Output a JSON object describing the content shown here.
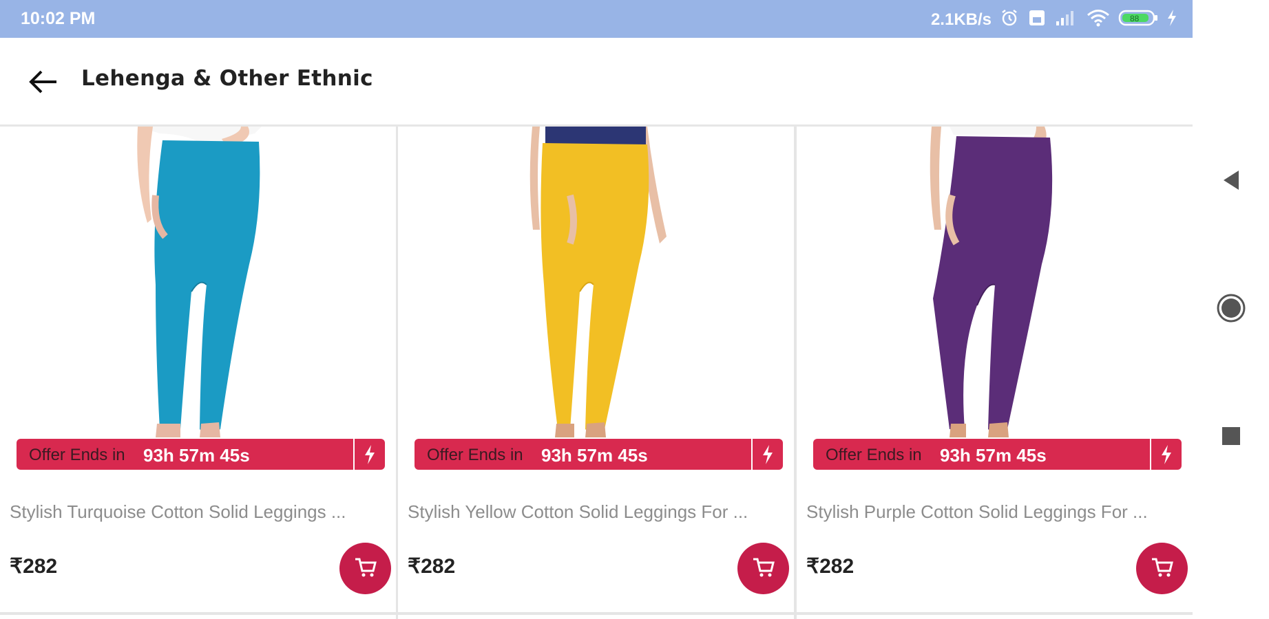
{
  "status_bar": {
    "time": "10:02 PM",
    "net_speed": "2.1KB/s",
    "battery": "88",
    "icons": [
      "alarm-icon",
      "sim-icon",
      "signal-icon",
      "wifi-icon",
      "battery-icon",
      "charging-icon"
    ]
  },
  "header": {
    "back_icon": "arrow-left-icon",
    "title": "Lehenga & Other Ethnic"
  },
  "products": [
    {
      "offer_label": "Offer Ends in",
      "offer_time": "93h 57m 45s",
      "name": "Stylish Turquoise Cotton Solid Leggings ...",
      "price": "₹282",
      "color": "#1b9bc4"
    },
    {
      "offer_label": "Offer Ends in",
      "offer_time": "93h 57m 45s",
      "name": "Stylish Yellow Cotton Solid Leggings For ...",
      "price": "₹282",
      "color": "#f2bf24"
    },
    {
      "offer_label": "Offer Ends in",
      "offer_time": "93h 57m 45s",
      "name": "Stylish Purple Cotton Solid Leggings For ...",
      "price": "₹282",
      "color": "#5b2d78"
    }
  ],
  "nav_bar": {
    "icons": [
      "back-triangle-icon",
      "home-circle-icon",
      "recents-square-icon"
    ]
  },
  "colors": {
    "status_bar_bg": "#98b4e6",
    "offer_banner": "#d8294f",
    "cart_button": "#c51d4a",
    "price_text": "#222222",
    "name_text": "#8c8c8c"
  }
}
